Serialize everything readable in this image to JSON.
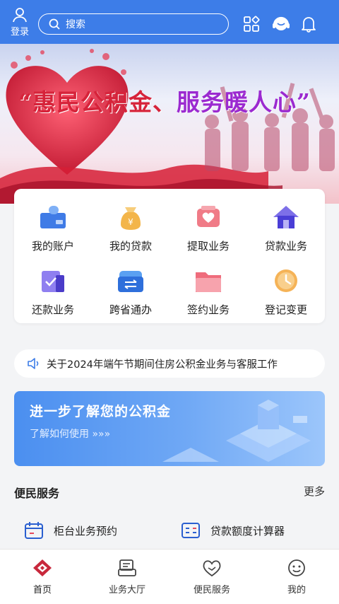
{
  "header": {
    "login_label": "登录",
    "search_placeholder": "搜索",
    "icons": [
      "user-icon",
      "search-icon",
      "apps-grid-icon",
      "customer-service-icon",
      "bell-icon"
    ]
  },
  "banner": {
    "title_part1": "“惠民公积金、",
    "title_part2": "服务暖人心”"
  },
  "quick_actions": [
    {
      "label": "我的账户",
      "icon": "account-card-icon"
    },
    {
      "label": "我的贷款",
      "icon": "money-bag-icon"
    },
    {
      "label": "提取业务",
      "icon": "withdraw-heart-icon"
    },
    {
      "label": "贷款业务",
      "icon": "house-icon"
    },
    {
      "label": "还款业务",
      "icon": "repay-check-icon"
    },
    {
      "label": "跨省通办",
      "icon": "transfer-arrows-icon"
    },
    {
      "label": "签约业务",
      "icon": "folder-icon"
    },
    {
      "label": "登记变更",
      "icon": "clock-icon"
    }
  ],
  "notice": {
    "text": "关于2024年端午节期间住房公积金业务与客服工作"
  },
  "promo": {
    "title": "进一步了解您的公积金",
    "subtitle": "了解如何使用 »»»"
  },
  "services": {
    "title": "便民服务",
    "more": "更多",
    "items": [
      {
        "label": "柜台业务预约",
        "icon": "calendar-icon"
      },
      {
        "label": "贷款额度计算器",
        "icon": "calculator-icon"
      }
    ]
  },
  "tabbar": {
    "items": [
      {
        "label": "首页",
        "icon": "home-logo-icon",
        "active": true
      },
      {
        "label": "业务大厅",
        "icon": "business-hall-icon"
      },
      {
        "label": "便民服务",
        "icon": "heart-hand-icon"
      },
      {
        "label": "我的",
        "icon": "profile-face-icon"
      }
    ]
  },
  "colors": {
    "primary": "#3d7de8",
    "banner_red": "#d6233a",
    "banner_purple": "#9b2ad0",
    "active_tab": "#c8283c"
  }
}
